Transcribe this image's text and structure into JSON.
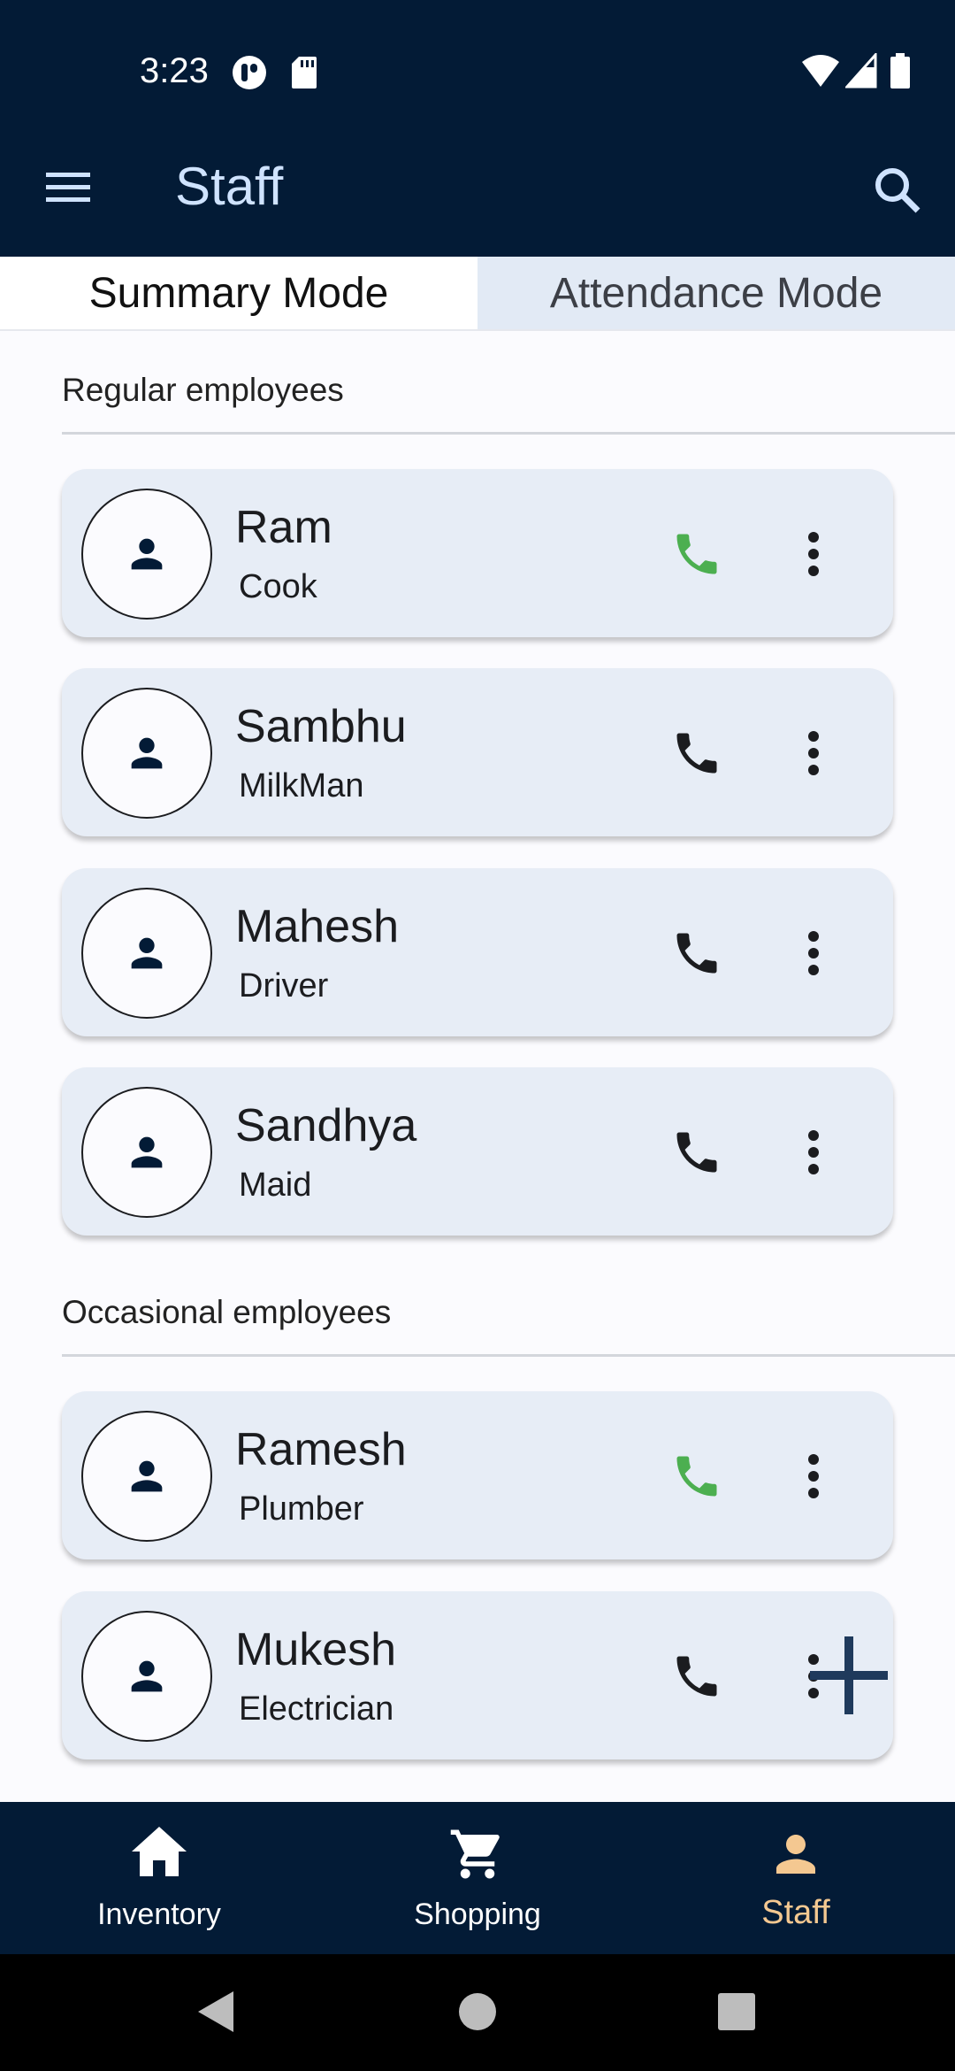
{
  "status_bar": {
    "time": "3:23",
    "icons": [
      "lens-icon",
      "sd-card-icon",
      "wifi-icon",
      "signal-icon",
      "battery-icon"
    ]
  },
  "app_bar": {
    "title": "Staff",
    "menu_icon": "menu-icon",
    "search_icon": "search-icon"
  },
  "tabs": [
    {
      "label": "Summary Mode",
      "active": true
    },
    {
      "label": "Attendance Mode",
      "active": false
    }
  ],
  "sections": {
    "regular": {
      "title": "Regular employees",
      "employees": [
        {
          "name": "Ram",
          "role": "Cook",
          "phone_color": "#4caf50"
        },
        {
          "name": "Sambhu",
          "role": "MilkMan",
          "phone_color": "#1b1c1f"
        },
        {
          "name": "Mahesh",
          "role": "Driver",
          "phone_color": "#1b1c1f"
        },
        {
          "name": "Sandhya",
          "role": "Maid",
          "phone_color": "#1b1c1f"
        }
      ]
    },
    "occasional": {
      "title": "Occasional employees",
      "employees": [
        {
          "name": "Ramesh",
          "role": "Plumber",
          "phone_color": "#4caf50"
        },
        {
          "name": "Mukesh",
          "role": "Electrician",
          "phone_color": "#1b1c1f"
        }
      ]
    }
  },
  "fab": {
    "icon": "plus-icon"
  },
  "bottom_nav": [
    {
      "label": "Inventory",
      "icon": "home-icon",
      "active": false
    },
    {
      "label": "Shopping",
      "icon": "cart-icon",
      "active": false
    },
    {
      "label": "Staff",
      "icon": "person-icon",
      "active": true
    }
  ],
  "colors": {
    "app_bar": "#031b36",
    "card": "#e7edf6",
    "accent_active": "#f4c891",
    "call_active": "#4caf50"
  }
}
